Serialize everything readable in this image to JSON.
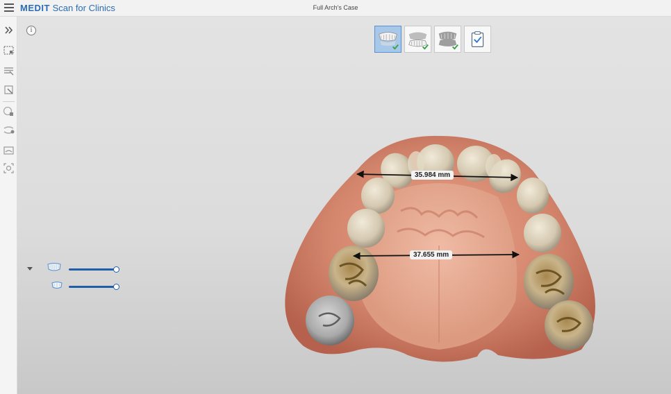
{
  "app": {
    "brand_name": "MEDIT",
    "brand_suffix": "Scan for Clinics",
    "case_title": "Full Arch's Case"
  },
  "toolbar": {
    "items": [
      {
        "icon": "expand-panel-icon"
      },
      {
        "icon": "select-area-icon"
      },
      {
        "icon": "trim-icon"
      },
      {
        "icon": "lasso-icon"
      },
      {
        "icon": "lock-scan-icon"
      },
      {
        "icon": "bite-icon"
      },
      {
        "icon": "align-icon"
      },
      {
        "icon": "capture-icon"
      }
    ]
  },
  "stages": [
    {
      "name": "maxilla",
      "active": true,
      "done": true
    },
    {
      "name": "mandible",
      "active": false,
      "done": true
    },
    {
      "name": "occlusion",
      "active": false,
      "done": true
    },
    {
      "name": "review",
      "active": false,
      "done": false
    }
  ],
  "layers": [
    {
      "name": "maxilla",
      "opacity": 1.0
    },
    {
      "name": "maxilla-sub",
      "opacity": 1.0
    }
  ],
  "measurements": [
    {
      "label": "35.984 mm"
    },
    {
      "label": "37.655 mm"
    }
  ],
  "colors": {
    "accent": "#2a6cb3",
    "slider": "#1f5fa8",
    "active_stage": "#a8c8ea",
    "check": "#3aa04a",
    "gum": "#d4866d",
    "tooth": "#ddd3bf"
  }
}
